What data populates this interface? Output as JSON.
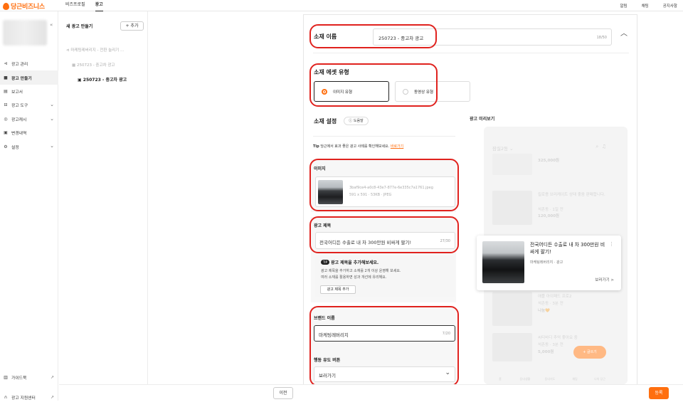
{
  "topbar": {
    "logo_text": "당근비즈니스",
    "nav": [
      "비즈프로필",
      "광고"
    ],
    "right_links": [
      "알림",
      "채팅",
      "공지사항"
    ]
  },
  "sidebar": {
    "items": [
      {
        "label": "광고 관리",
        "icon": "megaphone-icon",
        "chevron": false
      },
      {
        "label": "광고 만들기",
        "icon": "plus-square-icon",
        "chevron": false,
        "selected": true
      },
      {
        "label": "보고서",
        "icon": "report-icon",
        "chevron": false
      },
      {
        "label": "광고 도구",
        "icon": "toolbox-icon",
        "chevron": true
      },
      {
        "label": "광고캐시",
        "icon": "coin-icon",
        "chevron": true
      },
      {
        "label": "변경내역",
        "icon": "history-icon",
        "chevron": false
      },
      {
        "label": "설정",
        "icon": "gear-icon",
        "chevron": true
      }
    ],
    "bottom": [
      {
        "label": "가이드북",
        "icon": "book-icon"
      },
      {
        "label": "광고 지원센터",
        "icon": "headset-icon"
      }
    ]
  },
  "tree": {
    "header": "새 광고 만들기",
    "add_label": "+ 추가",
    "level1": "마케팅레버리지 - 전환 늘리기 ...",
    "level2": "250723 - 중고차 광고",
    "level3": "250723 - 중고차 광고"
  },
  "form": {
    "name": {
      "label": "소재 이름",
      "value": "250723 - 중고차 광고",
      "counter": "18/50"
    },
    "asset_type": {
      "label": "소재 에셋 유형",
      "options": [
        "이미지 유형",
        "동영상 유형"
      ],
      "selected": "이미지 유형"
    },
    "settings": {
      "label": "소재 설정",
      "help": "도움말"
    },
    "tip": {
      "prefix": "Tip",
      "text": "당근에서 효과 좋은 광고 사례를 확인해보세요.",
      "link": "바로가기"
    },
    "image": {
      "label": "이미지",
      "filename": "3baf9ce4-a0c8-43e7-877e-6e335c7a1761.jpeg",
      "meta": "591 x 591 · 53KB · JPEG"
    },
    "ad_title": {
      "label": "광고 제목",
      "value": "전국어디든 수출로 내 차 300만원 비싸게 팔기!",
      "counter": "27/30"
    },
    "title_tip": {
      "badge": "TIP",
      "title": "광고 제목을 추가해보세요.",
      "line1": "광고 제목을 추가하고 소재를 2개 이상 운영해 보세요.",
      "line2": "여러 소재를 활용하면 성과 개선에 유리해요.",
      "button": "광고 제목 추가"
    },
    "brand": {
      "label": "브랜드 이름",
      "value": "마케팅레버리지",
      "counter": "7/20"
    },
    "cta": {
      "label": "행동 유도 버튼",
      "value": "보러가기"
    }
  },
  "preview": {
    "label": "광고 미리보기",
    "location": "잠실2동 ⌄",
    "items": [
      {
        "price": "325,000원"
      },
      {
        "title": "킬로용 브리케이트 상태 좋음 판매합니다.",
        "meta": "석촌동 · 1일 전",
        "price": "120,000원"
      },
      {
        "title": "애플 아이패드 프로2",
        "meta": "석촌동 · 3분 전",
        "price": "나눔🧡"
      },
      {
        "title": "씨티바디 추억 좋아요 중",
        "meta": "석촌동 · 3분 전",
        "price": "5,000원"
      }
    ],
    "ad": {
      "title": "전국어디든 수출로 내 차 300만원 비싸게 팔기!",
      "sub": "마케팅레버리지 · 광고",
      "more": "보러가기 >"
    },
    "fab": "+ 글쓰기",
    "tabs": [
      "홈",
      "동네생활",
      "동네지도",
      "채팅",
      "나의 당근"
    ]
  },
  "footer": {
    "prev": "이전",
    "register": "등록"
  }
}
